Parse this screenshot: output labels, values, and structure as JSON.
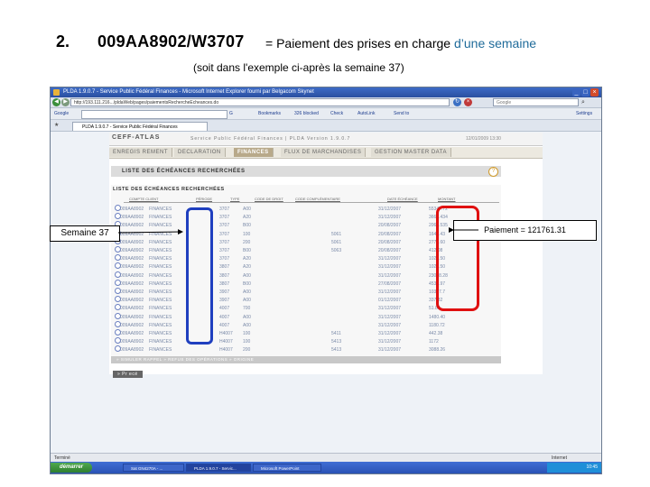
{
  "slide": {
    "number": "2.",
    "code": "009AA8902/W3707",
    "title_rest_a": " = Paiement des prises en charge ",
    "title_rest_b": "d’une semaine",
    "subtitle": "(soit dans l'exemple ci-après la semaine 37)"
  },
  "browser": {
    "title": "PLDA 1.9.0.7 - Service Public Fédéral Finances - Microsoft Internet Explorer fourni par Belgacom Skynet",
    "address": "http://193.111.216.../pldaWeb/pages/paiementsRechercheEcheances.do",
    "search_placeholder": "Google",
    "tab_label": "PLDA 1.9.0.7 - Service Public Fédéral Finances",
    "toolbar": {
      "google": "Google",
      "go": "G",
      "bookmarks": "Bookmarks",
      "blocked": "326 blocked",
      "check": "Check",
      "autolink": "AutoLink",
      "send": "Send to",
      "settings": "Settings"
    }
  },
  "app": {
    "brand": "CEFF-ATLAS",
    "banner": "Service Public Fédéral Finances | PLDA Version 1.9.0.7",
    "banner_date": "12/01/2009 13:30",
    "menu": [
      {
        "label": "ENREGIS REMENT",
        "active": false
      },
      {
        "label": "DECLARATION",
        "active": false
      },
      {
        "label": "FINANCES",
        "active": true
      },
      {
        "label": "FLUX DE MARCHANDISES",
        "active": false
      },
      {
        "label": "GESTION MASTER DATA",
        "active": false
      }
    ],
    "section_title": "LISTE DES ÉCHÉANCES RECHERCHÉES",
    "section_icon": "?",
    "list_title": "LISTE DES ÉCHÉANCES RECHERCHÉES",
    "headers": [
      "COMPTE CLIENT",
      "PÉRIODE",
      "TYPE",
      "CODE DE DROIT",
      "CODE COMPLÉMENTAIRE",
      "DATE ÉCHÉANCE",
      "MONTANT"
    ],
    "rows": [
      [
        "009AA8902",
        "FINANCES",
        "3707",
        "A00",
        "",
        "31/12/2007",
        "55347.72"
      ],
      [
        "009AA8902",
        "FINANCES",
        "3707",
        "A20",
        "",
        "31/12/2007",
        "3661.434"
      ],
      [
        "009AA8902",
        "FINANCES",
        "3707",
        "B00",
        "",
        "20/08/2007",
        "2067.535"
      ],
      [
        "009AA8902",
        "FINANCES",
        "3707",
        "100",
        "5061",
        "20/08/2007",
        "1647.43"
      ],
      [
        "009AA8902",
        "FINANCES",
        "3707",
        "200",
        "5061",
        "20/08/2007",
        "2779.60"
      ],
      [
        "009AA8902",
        "FINANCES",
        "3707",
        "B00",
        "5063",
        "20/08/2007",
        "412.08"
      ],
      [
        "009AA8902",
        "FINANCES",
        "3707",
        "A20",
        "",
        "31/12/2007",
        "1028.50"
      ],
      [
        "009AA8902",
        "FINANCES",
        "3807",
        "A20",
        "",
        "31/12/2007",
        "1025.50"
      ],
      [
        "009AA8902",
        "FINANCES",
        "3807",
        "A00",
        "",
        "31/12/2007",
        "23048.28"
      ],
      [
        "009AA8902",
        "FINANCES",
        "3807",
        "B00",
        "",
        "27/08/2007",
        "4539.97"
      ],
      [
        "009AA8902",
        "FINANCES",
        "3907",
        "A00",
        "",
        "31/12/2007",
        "10357.7"
      ],
      [
        "009AA8902",
        "FINANCES",
        "3907",
        "A00",
        "",
        "01/12/2007",
        "337.82"
      ],
      [
        "009AA8902",
        "FINANCES",
        "4007",
        "700",
        "",
        "31/12/2007",
        "51.80"
      ],
      [
        "009AA8902",
        "FINANCES",
        "4007",
        "A00",
        "",
        "31/12/2007",
        "1480.40"
      ],
      [
        "009AA8902",
        "FINANCES",
        "4007",
        "A00",
        "",
        "31/12/2007",
        "1180.72"
      ],
      [
        "009AA8902",
        "FINANCES",
        "H4007",
        "100",
        "5411",
        "31/12/2007",
        "442.38"
      ],
      [
        "009AA8902",
        "FINANCES",
        "H4007",
        "100",
        "5413",
        "31/12/2007",
        "1172"
      ],
      [
        "009AA8902",
        "FINANCES",
        "H4007",
        "200",
        "5413",
        "31/12/2007",
        "3088.26"
      ]
    ],
    "summary_bar": "» SIMULER RAPPEL  » REFUS DES OPÉRATIONS  » ORIGINE",
    "previous_button": "» Pr ecé"
  },
  "statusbar": {
    "left": "Terminé",
    "right": "Internet"
  },
  "taskbar": {
    "start": "démarrer",
    "tasks": [
      {
        "label": "Sat GN4270A - ...",
        "active": false
      },
      {
        "label": "PLDA 1.9.0.7 - Servic...",
        "active": true
      },
      {
        "label": "Microsoft PowerPoint",
        "active": false
      }
    ],
    "clock": "10:45"
  },
  "annotations": {
    "week": "Semaine 37",
    "payment": "Paiement = 121761.31"
  },
  "colors": {
    "titlebar": "#2a4fa0",
    "menu_active": "#b8a98a",
    "row_text": "#7a8aa8",
    "highlight_blue": "#1f3fbf",
    "highlight_red": "#e01010"
  }
}
